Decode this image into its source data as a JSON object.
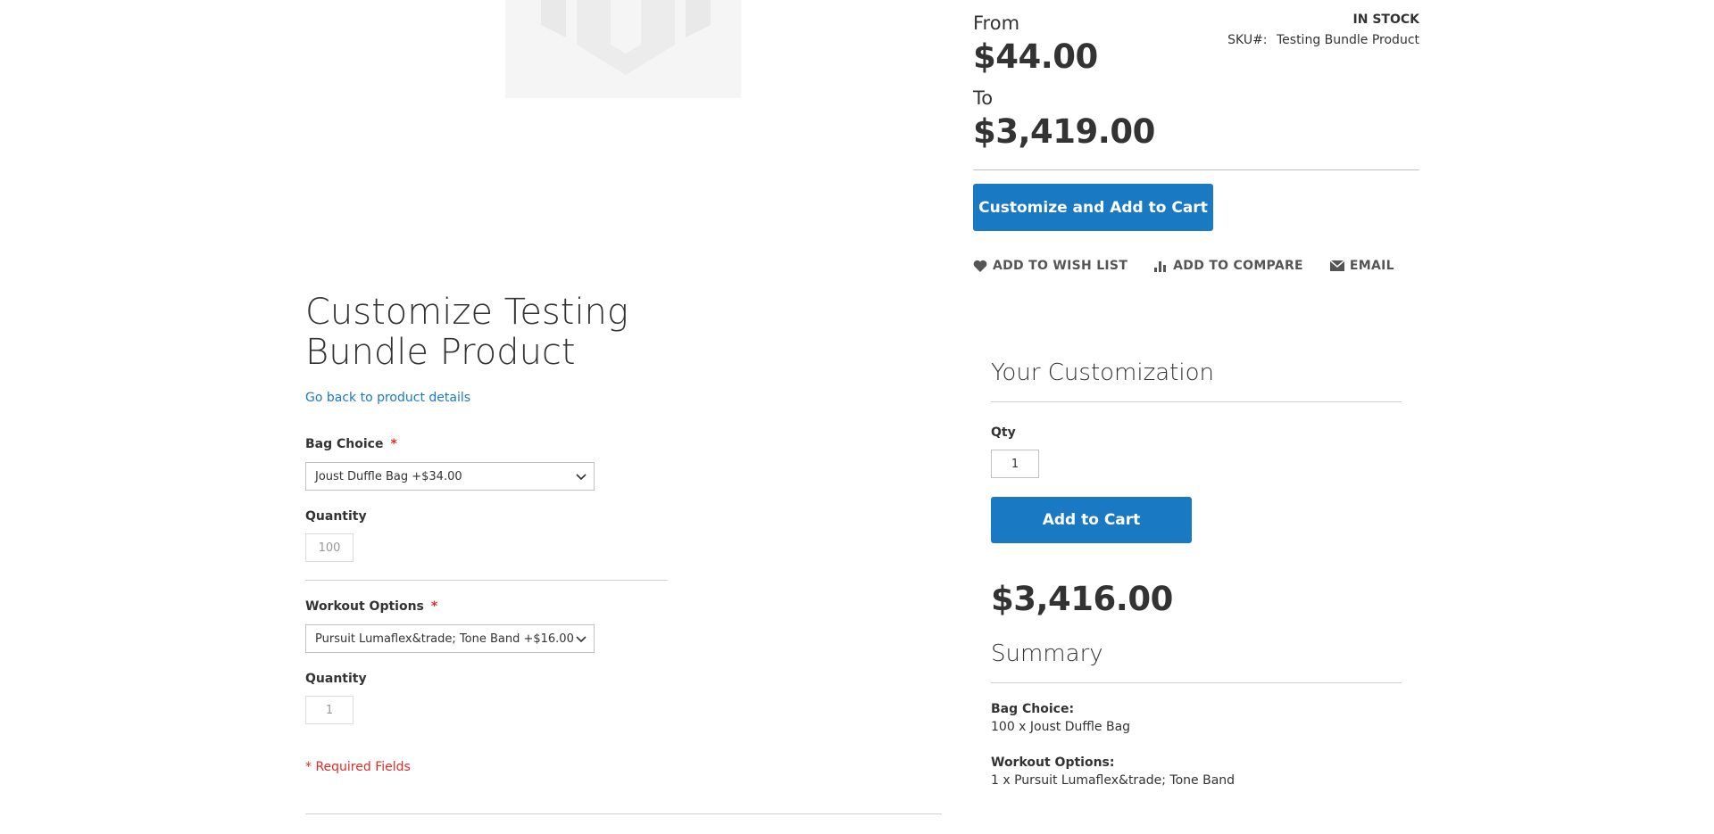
{
  "product": {
    "from_label": "From",
    "from_price": "$44.00",
    "to_label": "To",
    "to_price": "$3,419.00",
    "stock": "IN STOCK",
    "sku_label": "SKU#:",
    "sku_value": "Testing Bundle Product",
    "customize_button": "Customize and Add to Cart",
    "actions": {
      "wishlist": "ADD TO WISH LIST",
      "compare": "ADD TO COMPARE",
      "email": "EMAIL"
    }
  },
  "customize": {
    "title": "Customize Testing Bundle Product",
    "back_link": "Go back to product details",
    "options": [
      {
        "label": "Bag Choice",
        "required_mark": "*",
        "selected": "Joust Duffle Bag +$34.00",
        "quantity_label": "Quantity",
        "quantity": "100"
      },
      {
        "label": "Workout Options",
        "required_mark": "*",
        "selected": "Pursuit Lumaflex&trade; Tone Band +$16.00",
        "quantity_label": "Quantity",
        "quantity": "1"
      }
    ],
    "required_note": "* Required Fields"
  },
  "your_customization": {
    "title": "Your Customization",
    "qty_label": "Qty",
    "qty_value": "1",
    "add_to_cart": "Add to Cart",
    "total_price": "$3,416.00",
    "summary_title": "Summary",
    "summary": [
      {
        "label": "Bag Choice:",
        "value": "100 x Joust Duffle Bag"
      },
      {
        "label": "Workout Options:",
        "value": "1 x Pursuit Lumaflex&trade; Tone Band"
      }
    ]
  },
  "colors": {
    "primary": "#1979c3",
    "required": "#e02b27",
    "text": "#333333"
  }
}
